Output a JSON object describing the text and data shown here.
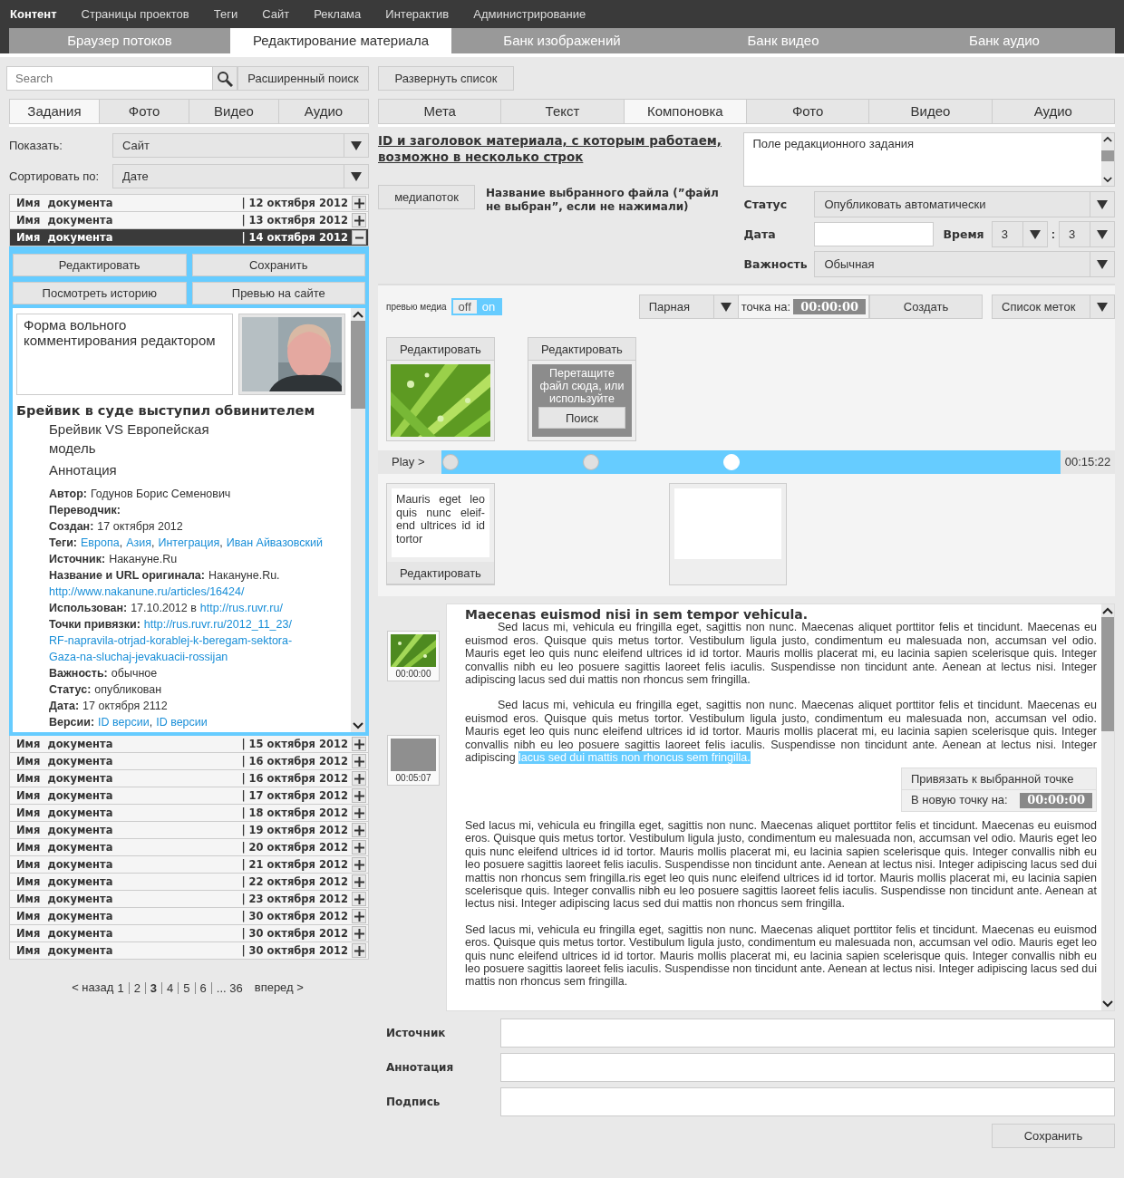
{
  "top_nav": [
    {
      "label": "Контент",
      "selected": true
    },
    {
      "label": "Страницы проектов",
      "selected": false
    },
    {
      "label": "Теги",
      "selected": false
    },
    {
      "label": "Сайт",
      "selected": false
    },
    {
      "label": "Реклама",
      "selected": false
    },
    {
      "label": "Интерактив",
      "selected": false
    },
    {
      "label": "Администрирование",
      "selected": false
    }
  ],
  "section_tabs": [
    {
      "label": "Браузер потоков",
      "selected": false
    },
    {
      "label": "Редактирование материала",
      "selected": true
    },
    {
      "label": "Банк изображений",
      "selected": false
    },
    {
      "label": "Банк видео",
      "selected": false
    },
    {
      "label": "Банк аудио",
      "selected": false
    }
  ],
  "left": {
    "search": {
      "placeholder": "Search"
    },
    "advanced_search": "Расширенный поиск",
    "tabs": [
      {
        "label": "Задания",
        "selected": true
      },
      {
        "label": "Фото",
        "selected": false
      },
      {
        "label": "Видео",
        "selected": false
      },
      {
        "label": "Аудио",
        "selected": false
      }
    ],
    "filters": [
      {
        "label": "Показать:",
        "value": "Сайт"
      },
      {
        "label": "Сортировать по:",
        "value": "Дате"
      }
    ],
    "documents": [
      {
        "name": "Имя  документа",
        "date": "| 12 октября 2012",
        "expanded": false
      },
      {
        "name": "Имя  документа",
        "date": "| 13 октября 2012",
        "expanded": false
      },
      {
        "name": "Имя  документа",
        "date": "| 14 октября 2012",
        "expanded": true
      },
      {
        "name": "Имя  документа",
        "date": "| 15 октября 2012",
        "expanded": false
      },
      {
        "name": "Имя  документа",
        "date": "| 16 октября 2012",
        "expanded": false
      },
      {
        "name": "Имя  документа",
        "date": "| 16 октября 2012",
        "expanded": false
      },
      {
        "name": "Имя  документа",
        "date": "| 17 октября 2012",
        "expanded": false
      },
      {
        "name": "Имя  документа",
        "date": "| 18 октября 2012",
        "expanded": false
      },
      {
        "name": "Имя  документа",
        "date": "| 19 октября 2012",
        "expanded": false
      },
      {
        "name": "Имя  документа",
        "date": "| 20 октября 2012",
        "expanded": false
      },
      {
        "name": "Имя  документа",
        "date": "| 21 октября 2012",
        "expanded": false
      },
      {
        "name": "Имя  документа",
        "date": "| 22 октября 2012",
        "expanded": false
      },
      {
        "name": "Имя  документа",
        "date": "| 23 октября 2012",
        "expanded": false
      },
      {
        "name": "Имя  документа",
        "date": "| 30 октября 2012",
        "expanded": false
      },
      {
        "name": "Имя  документа",
        "date": "| 30 октября 2012",
        "expanded": false
      },
      {
        "name": "Имя  документа",
        "date": "| 30 октября 2012",
        "expanded": false
      }
    ],
    "detail": {
      "actions": [
        "Редактировать",
        "Сохранить",
        "Посмотреть историю",
        "Превью на сайте"
      ],
      "comment": "Форма вольного комментирования редактором",
      "photo": {
        "kind": "picture"
      },
      "headline": "Брейвик в суде выступил обвинителем",
      "subtitle": "Брейвик VS Европейская модель",
      "annotation": "Аннотация",
      "meta": [
        {
          "label": "Автор:",
          "parts": [
            {
              "kind": "text",
              "text": "Годунов Борис Семенович"
            }
          ]
        },
        {
          "label": "Переводчик:"
        },
        {
          "label": "Создан:",
          "parts": [
            {
              "kind": "text",
              "text": "17 октября 2012"
            }
          ]
        },
        {
          "label": "Теги:",
          "parts": [
            {
              "kind": "link",
              "text": "Европа"
            },
            {
              "kind": "text",
              "text": ","
            },
            {
              "kind": "link",
              "text": "Азия"
            },
            {
              "kind": "text",
              "text": ","
            },
            {
              "kind": "link",
              "text": "Интеграция"
            },
            {
              "kind": "text",
              "text": ","
            },
            {
              "kind": "link",
              "text": "Иван Айвазовский"
            }
          ]
        },
        {
          "label": "Источник:",
          "parts": [
            {
              "kind": "text",
              "text": "Накануне.Ru"
            }
          ]
        },
        {
          "label": "Название и URL оригинала:",
          "parts": [
            {
              "kind": "text",
              "text": "Накануне.Ru."
            }
          ]
        },
        {
          "parts": [
            {
              "kind": "link",
              "text": "http://www.nakanune.ru/articles/16424/"
            }
          ]
        },
        {
          "label": "Использован:",
          "parts": [
            {
              "kind": "text",
              "text": "17.10.2012 в"
            },
            {
              "kind": "link",
              "text": "http://rus.ruvr.ru/"
            }
          ]
        },
        {
          "label": "Точки привязки:",
          "parts": [
            {
              "kind": "link",
              "text": "http://rus.ruvr.ru/2012_11_23/"
            }
          ]
        },
        {
          "parts": [
            {
              "kind": "link",
              "text": "RF-napravila-otrjad-korablej-k-beregam-sektora-"
            }
          ]
        },
        {
          "parts": [
            {
              "kind": "link",
              "text": "Gaza-na-sluchaj-jevakuacii-rossijan"
            }
          ]
        },
        {
          "label": "Важность:",
          "parts": [
            {
              "kind": "text",
              "text": "обычное"
            }
          ]
        },
        {
          "label": "Статус:",
          "parts": [
            {
              "kind": "text",
              "text": "опубликован"
            }
          ]
        },
        {
          "label": "Дата:",
          "parts": [
            {
              "kind": "text",
              "text": "17 октября 2112"
            }
          ]
        },
        {
          "label": "Версии:",
          "parts": [
            {
              "kind": "link",
              "text": "ID версии"
            },
            {
              "kind": "text",
              "text": ","
            },
            {
              "kind": "link",
              "text": "ID версии"
            }
          ]
        }
      ]
    },
    "pagination": {
      "prev": "< назад",
      "next": "вперед >",
      "pages": [
        {
          "label": "1",
          "selected": false
        },
        {
          "label": "2",
          "selected": false
        },
        {
          "label": "3",
          "selected": true
        },
        {
          "label": "4",
          "selected": false
        },
        {
          "label": "5",
          "selected": false
        },
        {
          "label": "6",
          "selected": false
        },
        {
          "label": "... 36",
          "selected": false
        }
      ]
    }
  },
  "right": {
    "expand_button": "Развернуть список",
    "tabs": [
      {
        "label": "Мета",
        "selected": false
      },
      {
        "label": "Текст",
        "selected": false
      },
      {
        "label": "Компоновка",
        "selected": true
      },
      {
        "label": "Фото",
        "selected": false
      },
      {
        "label": "Видео",
        "selected": false
      },
      {
        "label": "Аудио",
        "selected": false
      }
    ],
    "material_title": "ID и заголовок материала, с которым работаем, возможно в несколько строк",
    "media_button": "медиапоток",
    "file_name": "Название выбранного файла (”файл не выбран”, если не нажимали)",
    "task_field": {
      "placeholder": "Поле редакционного задания"
    },
    "status": {
      "label": "Статус",
      "value": "Опубликовать автоматически"
    },
    "date": {
      "label": "Дата"
    },
    "time": {
      "label": "Время",
      "hours": "3",
      "separator": ":",
      "minutes": "3"
    },
    "importance": {
      "label": "Важность",
      "value": "Обычная"
    },
    "media": {
      "preview_label": "превью медиа",
      "toggle": [
        {
          "label": "off",
          "selected": false
        },
        {
          "label": "on",
          "selected": true
        }
      ],
      "mark_type": "Парная",
      "point_label": "точка на:",
      "point_time": "00:00:00",
      "create": "Создать",
      "marks_list": "Список меток"
    },
    "timeline": {
      "play": "Play >",
      "duration": "00:15:22",
      "markers": [
        {
          "selected": false
        },
        {
          "selected": false
        },
        {
          "selected": true
        }
      ],
      "cards_above": [
        {
          "button": "Редактировать"
        },
        {
          "kind": "dropzone",
          "button": "Редактировать",
          "hint": "Перетащите файл сюда, или используйте",
          "action": "Поиск"
        }
      ],
      "cards_below": [
        {
          "kind": "text",
          "text": "Mauris eget leo quis nunc eleif-end ultrices id id tortor",
          "button": "Редактировать"
        },
        {
          "kind": "empty"
        }
      ]
    },
    "editor": {
      "anchors": [
        {
          "time": "00:00:00"
        },
        {
          "kind": "empty",
          "time": "00:05:07"
        }
      ],
      "heading": "Maecenas euismod nisi in sem tempor vehicula.",
      "paragraphs": [
        {
          "indent": true,
          "segments": [
            {
              "text": "Sed lacus mi, vehicula eu fringilla eget, sagittis non nunc. Maecenas aliquet porttitor felis et tincidunt. Maecenas eu euismod eros. Quisque quis metus tortor. Vestibulum ligula justo, condimentum eu malesuada non, accumsan vel odio. Mauris eget leo quis nunc eleifend ultrices id id tortor. Mauris mollis placerat mi, eu lacinia sapien scelerisque quis. Integer convallis nibh eu leo posuere sagittis laoreet felis iaculis. Suspendisse non tincidunt ante. Aenean at lectus nisi. Integer adipiscing lacus sed dui mattis non rhoncus sem fringilla.",
              "selected": false
            }
          ]
        },
        {
          "indent": true,
          "segments": [
            {
              "text": "Sed lacus mi, vehicula eu fringilla eget, sagittis non nunc. Maecenas aliquet porttitor felis et tincidunt. Maecenas eu euismod eros. Quisque quis metus tortor. Vestibulum ligula justo, condimentum eu malesuada non, accumsan vel odio. Mauris eget leo quis nunc eleifend ultrices id id tortor. Mauris mollis placerat mi, eu lacinia sapien scelerisque quis. Integer convallis nibh eu leo posuere sagittis laoreet felis iaculis. Suspendisse non tincidunt ante. Aenean at lectus nisi. Integer adipiscing ",
              "selected": false
            },
            {
              "text": "lacus sed dui mattis non rhoncus sem fringilla.",
              "selected": true
            }
          ]
        },
        {
          "indent": false,
          "segments": [
            {
              "text": "Sed lacus mi, vehicula eu fringilla eget, sagittis non nunc. Maecenas aliquet porttitor felis et tincidunt. Maecenas eu euismod eros. Quisque quis metus tortor. Vestibulum ligula justo, condimentum eu malesuada non, accumsan vel odio. Mauris eget leo quis nunc eleifend ultrices id id tortor. Mauris mollis placerat mi, eu lacinia sapien scelerisque quis. Integer convallis nibh eu leo posuere sagittis laoreet felis iaculis. Suspendisse non tincidunt ante. Aenean at lectus nisi. Integer adipiscing lacus sed dui mattis non rhoncus sem fringilla.ris eget leo quis nunc eleifend ultrices id id tortor. Mauris mollis placerat mi, eu lacinia sapien scelerisque quis. Integer convallis nibh eu leo posuere sagittis laoreet felis iaculis. Suspendisse non tincidunt ante. Aenean at lectus nisi. Integer adipiscing lacus sed dui mattis non rhoncus sem fringilla.",
              "selected": false
            }
          ]
        },
        {
          "indent": false,
          "segments": [
            {
              "text": "Sed lacus mi, vehicula eu fringilla eget, sagittis non nunc. Maecenas aliquet porttitor felis et tincidunt. Maecenas eu euismod eros. Quisque quis metus tortor. Vestibulum ligula justo, condimentum eu malesuada non, accumsan vel odio. Mauris eget leo quis nunc eleifend ultrices id id tortor. Mauris mollis placerat mi, eu lacinia sapien scelerisque quis. Integer convallis nibh eu leo posuere sagittis laoreet felis iaculis. Suspendisse non tincidunt ante. Aenean at lectus nisi. Integer adipiscing lacus sed dui mattis non rhoncus sem fringilla.",
              "selected": false
            }
          ]
        }
      ],
      "context_menu": {
        "item": "Привязать к выбранной точке",
        "new_point_label": "В новую точку на:",
        "new_point_time": "00:00:00"
      }
    },
    "fields": [
      {
        "label": "Источник"
      },
      {
        "label": "Аннотация"
      },
      {
        "label": "Подпись"
      }
    ],
    "save": "Сохранить"
  }
}
